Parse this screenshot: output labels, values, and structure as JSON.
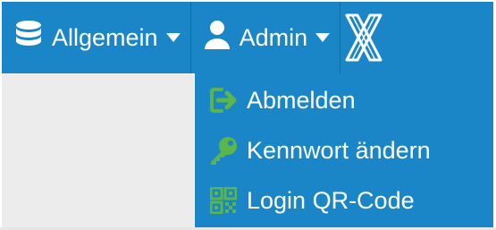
{
  "topbar": {
    "menus": [
      {
        "label": "Allgemein",
        "icon": "database-icon"
      },
      {
        "label": "Admin",
        "icon": "user-icon"
      }
    ],
    "logo_icon": "x-logo-icon"
  },
  "dropdown": {
    "items": [
      {
        "label": "Abmelden",
        "icon": "sign-out-icon"
      },
      {
        "label": "Kennwort ändern",
        "icon": "key-icon"
      },
      {
        "label": "Login QR-Code",
        "icon": "qr-code-icon"
      }
    ]
  },
  "colors": {
    "bar": "#1a86c8",
    "icon_accent": "#5cb548",
    "text": "#ffffff"
  }
}
